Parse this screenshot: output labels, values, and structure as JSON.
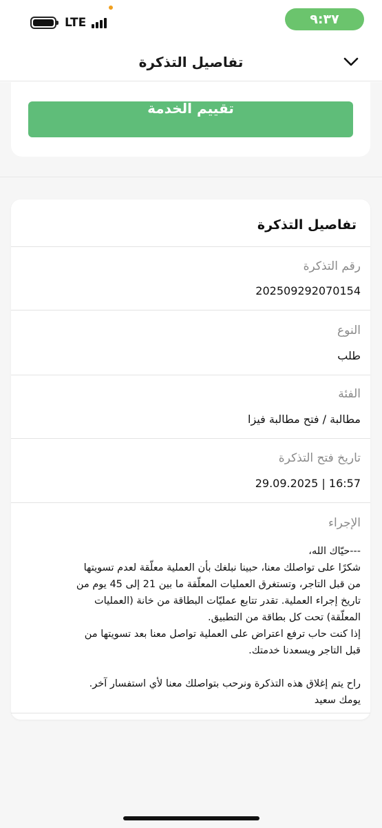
{
  "status_bar": {
    "time": "٩:٣٧",
    "network": "LTE"
  },
  "header": {
    "title": "تفاصيل التذكرة"
  },
  "top_card": {
    "rate_button_label": "تقييم الخدمة"
  },
  "details": {
    "title": "تفاصيل التذكرة",
    "fields": [
      {
        "label": "رقم التذكرة",
        "value": "202509292070154"
      },
      {
        "label": "النوع",
        "value": "طلب"
      },
      {
        "label": "الفئة",
        "value": "مطالبة / فتح مطالبة فيزا"
      },
      {
        "label": "تاريخ فتح التذكرة",
        "value": "29.09.2025 | 16:57"
      }
    ],
    "action": {
      "label": "الإجراء",
      "lines": [
        "---حيّاك الله،",
        "شكرًا على تواصلك معنا، حبينا نبلغك بأن العملية معلّقة لعدم تسويتها",
        "من قبل التاجر، وتستغرق العمليات المعلّقة ما بين 21 إلى 45 يوم من",
        "تاريخ إجراء العملية. تقدر تتابع عمليّات البطاقة من خانة (العمليات",
        "المعلّقة) تحت كل بطاقة من التطبيق.",
        "إذا كنت حاب ترفع اعتراض على العملية تواصل معنا بعد تسويتها من",
        "قبل التاجر ويسعدنا خدمتك.",
        "",
        "راح يتم إغلاق هذه التذكرة ونرحب بتواصلك معنا لأي استفسار آخر.",
        "يومك سعيد"
      ]
    }
  },
  "colors": {
    "accent_green": "#5fbd79",
    "time_pill": "#6bc46d",
    "background": "#f6f6f6"
  },
  "icons": {
    "header_left": "chevron-down-icon",
    "battery": "battery-icon",
    "signal": "signal-bars-icon"
  }
}
